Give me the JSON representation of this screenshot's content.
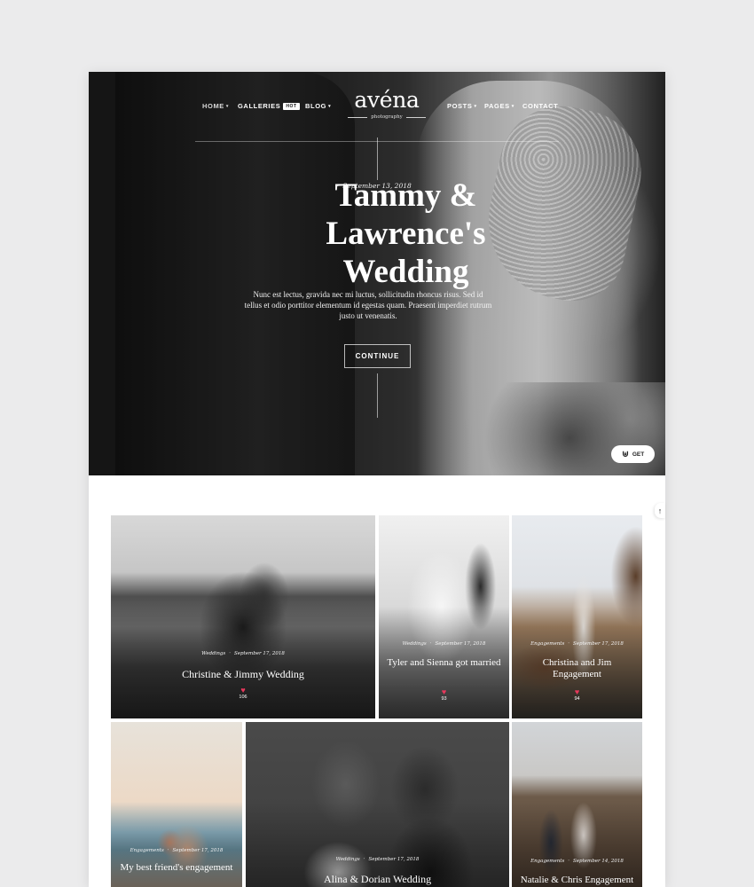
{
  "header": {
    "nav": [
      {
        "label": "HOME",
        "has_dropdown": true
      },
      {
        "label": "GALLERIES",
        "badge": "HOT",
        "has_dropdown": false
      },
      {
        "label": "BLOG",
        "has_dropdown": true
      },
      {
        "label": "POSTS",
        "has_dropdown": true
      },
      {
        "label": "PAGES",
        "has_dropdown": true
      },
      {
        "label": "CONTACT",
        "has_dropdown": false
      }
    ],
    "logo": {
      "name": "avéna",
      "tagline": "photography"
    },
    "caret": "▾"
  },
  "hero": {
    "date": "September 13, 2018",
    "title": "Tammy & Lawrence's Wedding",
    "excerpt": "Nunc est lectus, gravida nec mi luctus, sollicitudin rhoncus risus. Sed id tellus et odio porttitor elementum id egestas quam. Praesent imperdiet rutrum justo ut venenatis.",
    "continue_label": "CONTINUE",
    "get_label": "GET",
    "get_icon": "download-icon"
  },
  "grid": {
    "posts": [
      {
        "category": "Weddings",
        "date": "September 17, 2018",
        "title": "Christine & Jimmy Wedding",
        "likes": "106"
      },
      {
        "category": "Weddings",
        "date": "September 17, 2018",
        "title": "Tyler and Sienna got married",
        "likes": "93"
      },
      {
        "category": "Engagements",
        "date": "September 17, 2018",
        "title": "Christina and Jim Engagement",
        "likes": "94"
      },
      {
        "category": "Engagements",
        "date": "September 17, 2018",
        "title": "My best friend's engagement",
        "likes": ""
      },
      {
        "category": "Weddings",
        "date": "September 17, 2018",
        "title": "Alina & Dorian Wedding",
        "likes": ""
      },
      {
        "category": "Engagements",
        "date": "September 14, 2018",
        "title": "Natalie & Chris Engagement",
        "likes": ""
      }
    ]
  },
  "scroll_top": {
    "glyph": "↑",
    "icon": "arrow-up-icon"
  },
  "colors": {
    "heart": "#e8385c",
    "page_bg": "#ebebec"
  }
}
